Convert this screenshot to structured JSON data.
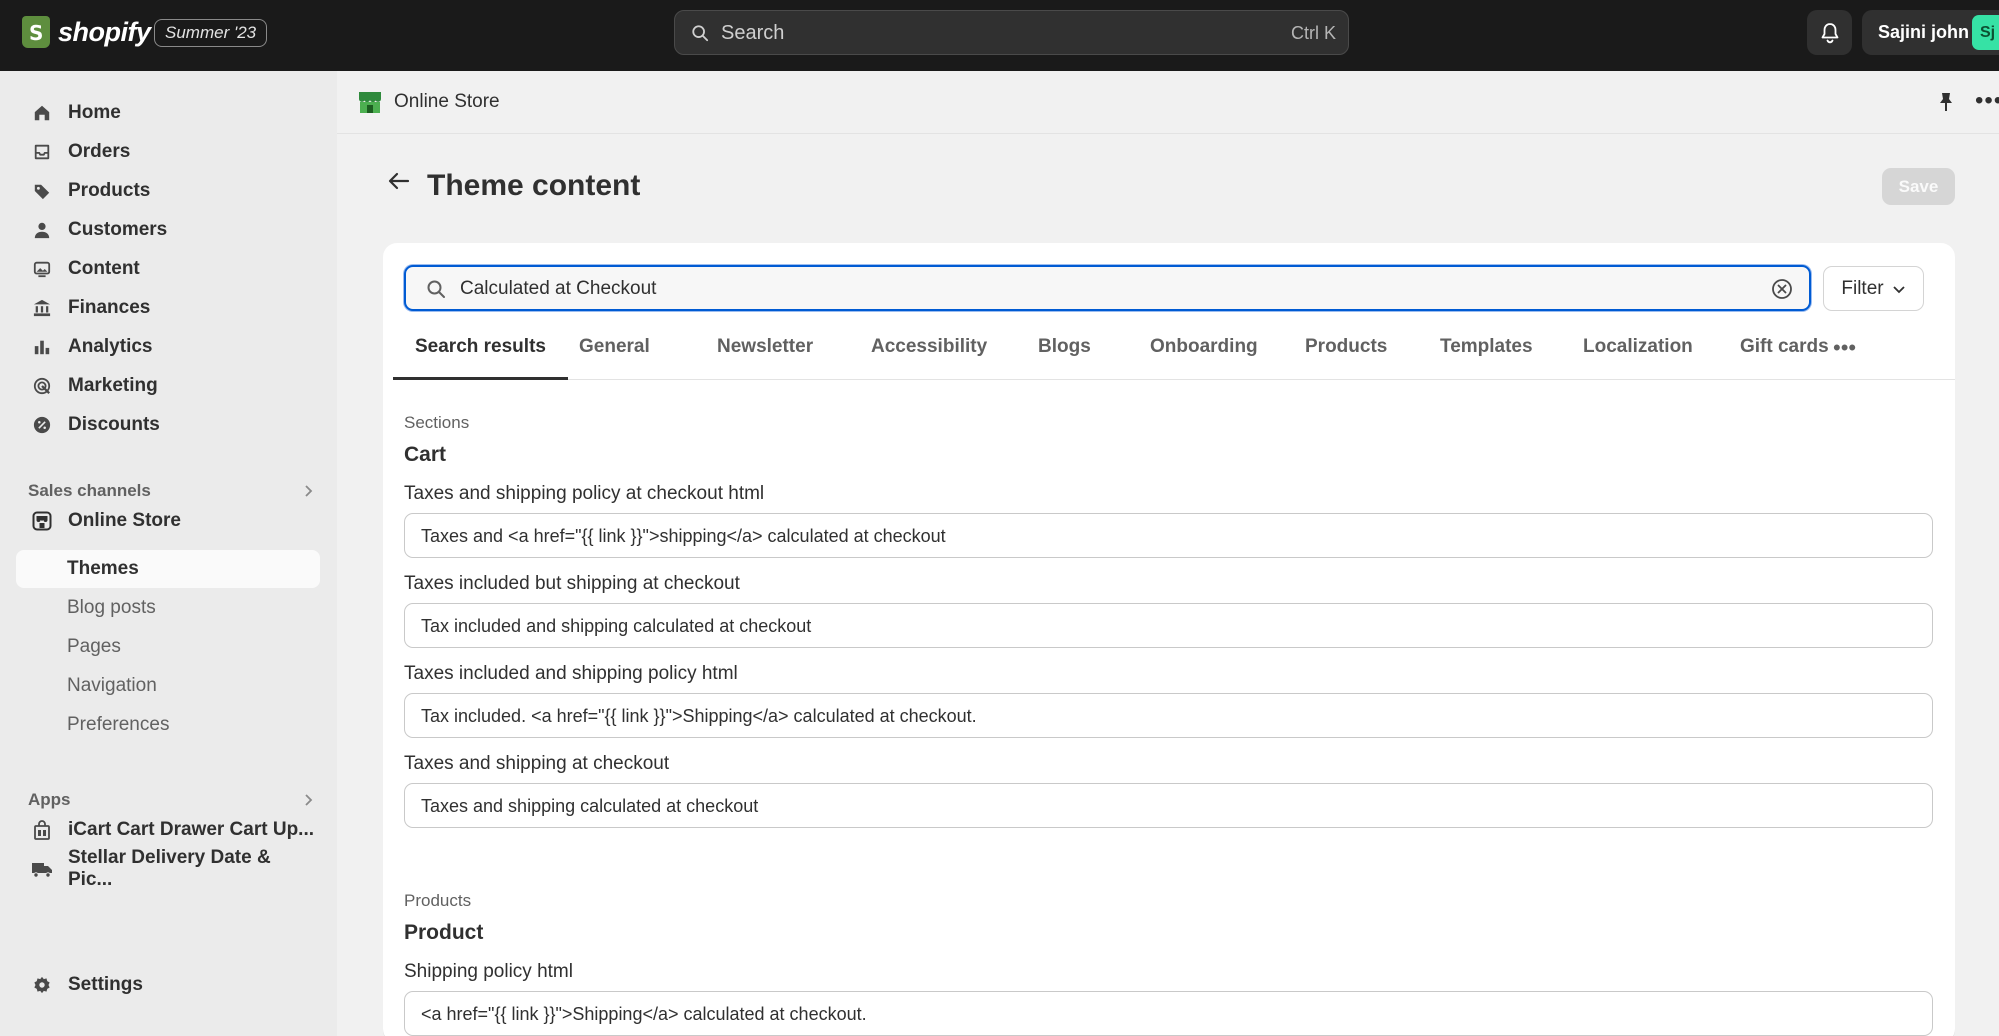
{
  "topbar": {
    "brand": "shopify",
    "edition": "Summer '23",
    "search_label": "Search",
    "search_shortcut": "Ctrl K",
    "user_name": "Sajini john",
    "user_initials": "Sj"
  },
  "sidebar": {
    "items": [
      {
        "label": "Home"
      },
      {
        "label": "Orders"
      },
      {
        "label": "Products"
      },
      {
        "label": "Customers"
      },
      {
        "label": "Content"
      },
      {
        "label": "Finances"
      },
      {
        "label": "Analytics"
      },
      {
        "label": "Marketing"
      },
      {
        "label": "Discounts"
      }
    ],
    "sales_channels_label": "Sales channels",
    "online_store_label": "Online Store",
    "sub_items": [
      {
        "label": "Themes"
      },
      {
        "label": "Blog posts"
      },
      {
        "label": "Pages"
      },
      {
        "label": "Navigation"
      },
      {
        "label": "Preferences"
      }
    ],
    "apps_label": "Apps",
    "apps": [
      {
        "label": "iCart Cart Drawer Cart Up..."
      },
      {
        "label": "Stellar Delivery Date & Pic..."
      }
    ],
    "settings_label": "Settings"
  },
  "store_bar": {
    "title": "Online Store"
  },
  "page": {
    "title": "Theme content",
    "save_label": "Save"
  },
  "search": {
    "value": "Calculated at Checkout",
    "filter_label": "Filter"
  },
  "tabs": [
    {
      "label": "Search results"
    },
    {
      "label": "General"
    },
    {
      "label": "Newsletter"
    },
    {
      "label": "Accessibility"
    },
    {
      "label": "Blogs"
    },
    {
      "label": "Onboarding"
    },
    {
      "label": "Products"
    },
    {
      "label": "Templates"
    },
    {
      "label": "Localization"
    },
    {
      "label": "Gift cards"
    }
  ],
  "groups": [
    {
      "group_label": "Sections",
      "title": "Cart",
      "fields": [
        {
          "label": "Taxes and shipping policy at checkout html",
          "value": "Taxes and <a href=\"{{ link }}\">shipping</a> calculated at checkout"
        },
        {
          "label": "Taxes included but shipping at checkout",
          "value": "Tax included and shipping calculated at checkout"
        },
        {
          "label": "Taxes included and shipping policy html",
          "value": "Tax included. <a href=\"{{ link }}\">Shipping</a> calculated at checkout."
        },
        {
          "label": "Taxes and shipping at checkout",
          "value": "Taxes and shipping calculated at checkout"
        }
      ]
    },
    {
      "group_label": "Products",
      "title": "Product",
      "fields": [
        {
          "label": "Shipping policy html",
          "value": "<a href=\"{{ link }}\">Shipping</a> calculated at checkout."
        }
      ]
    }
  ]
}
